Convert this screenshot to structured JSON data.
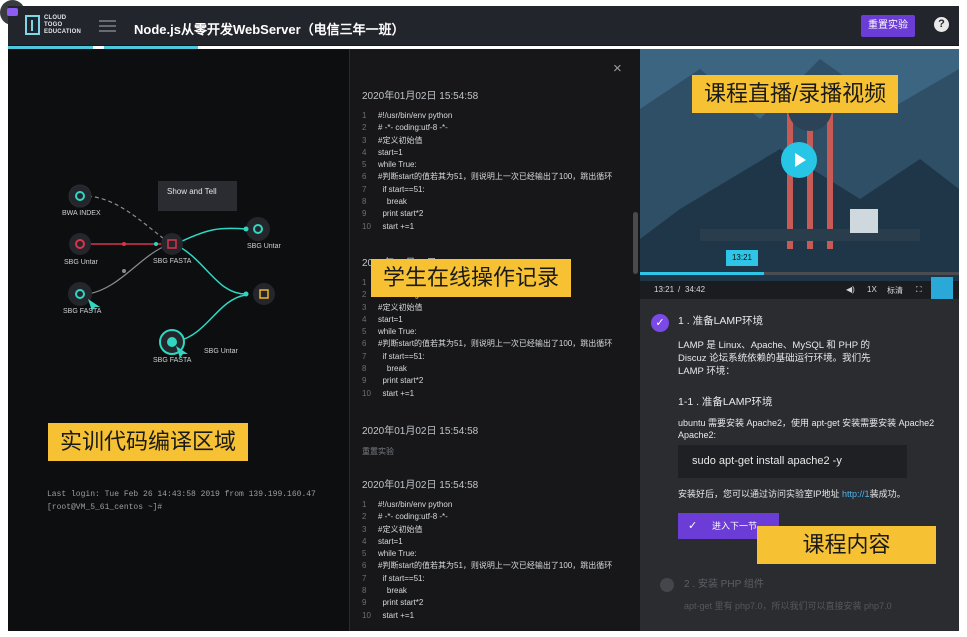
{
  "topbar": {
    "logo_line1": "CLOUD",
    "logo_line2": "TOGO",
    "logo_line3": "EDUCATION",
    "title": "Node.js从零开发WebServer（电信三年一班）",
    "reset_label": "重置实验",
    "help_label": "?"
  },
  "labels": {
    "code_area": "实训代码编译区域",
    "operation_log": "学生在线操作记录",
    "live_video": "课程直播/录播视频",
    "course_content": "课程内容"
  },
  "workflow": {
    "tooltip": "Show and Tell",
    "nodes": [
      "BWA INDEX",
      "SBG Untar",
      "SBG FASTA",
      "SBG Untar",
      "SBG FASTA",
      "SBG FASTA",
      "SBG Untar"
    ]
  },
  "terminal": {
    "line1": "Last login: Tue Feb 26 14:43:58 2019 from 139.199.160.47",
    "line2": "[root@VM_5_61_centos ~]#"
  },
  "log": {
    "close_label": "×",
    "entries": [
      {
        "timestamp": "2020年01月02日 15:54:58"
      },
      {
        "timestamp": "2020年01月02日 15:54:58"
      },
      {
        "timestamp": "2020年01月02日 15:54:58",
        "text": "重置实验"
      },
      {
        "timestamp": "2020年01月02日 15:54:58"
      }
    ],
    "code_lines": [
      {
        "n": "1",
        "t": "#!/usr/bin/env python"
      },
      {
        "n": "2",
        "t": "# -*- coding:utf-8 -*-"
      },
      {
        "n": "3",
        "t": "#定义初始值"
      },
      {
        "n": "4",
        "t": "start=1"
      },
      {
        "n": "5",
        "t": "while True:"
      },
      {
        "n": "6",
        "t": "#判断start的值若其为51，则说明上一次已经输出了100，跳出循环"
      },
      {
        "n": "7",
        "t": "  if start==51:"
      },
      {
        "n": "8",
        "t": "    break"
      },
      {
        "n": "9",
        "t": "  print start*2"
      },
      {
        "n": "10",
        "t": "  start +=1"
      }
    ]
  },
  "video": {
    "hover_time": "13:21",
    "current_time": "13:21",
    "separator": "/",
    "duration": "34:42",
    "speed": "1X",
    "quality": "标清",
    "progress": 0.39
  },
  "course": {
    "step1_title": "1 . 准备LAMP环境",
    "step1_desc_1": "LAMP 是 Linux、Apache、MySQL 和 PHP 的",
    "step1_desc_2": "Discuz 论坛系统依赖的基础运行环境。我们先",
    "step1_desc_3": "LAMP 环境：",
    "sub_title": "1-1 . 准备LAMP环境",
    "sub_desc_1": "ubuntu 需要安装 Apache2，使用 apt-get 安装需要安装 Apache2",
    "sub_desc_2": "Apache2:",
    "command": "sudo apt-get install apache2 -y",
    "after_install_1": "安装好后，您可以通过访问实验室IP地址",
    "after_install_link": "http://1",
    "after_install_2": "装成功。",
    "next_label": "进入下一节",
    "step2_title": "2 . 安装 PHP 组件",
    "step2_desc": "apt-get 里有 php7.0，所以我们可以直接安装 php7.0"
  }
}
